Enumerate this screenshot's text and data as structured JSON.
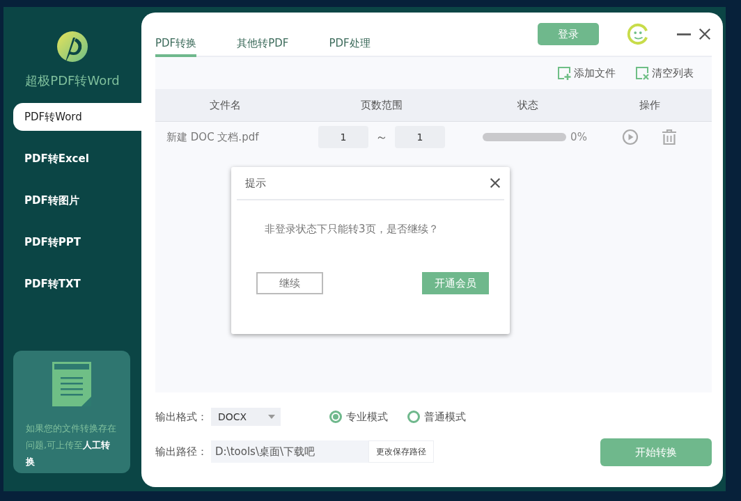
{
  "app": {
    "title": "超极PDF转Word"
  },
  "sidebar": {
    "items": [
      {
        "label": "PDF转Word",
        "selected": true
      },
      {
        "label": "PDF转Excel",
        "selected": false
      },
      {
        "label": "PDF转图片",
        "selected": false
      },
      {
        "label": "PDF转PPT",
        "selected": false
      },
      {
        "label": "PDF转TXT",
        "selected": false
      }
    ],
    "help": {
      "text": "如果您的文件转换存在问题,可上传至**人工转换**"
    }
  },
  "tabs": [
    {
      "label": "PDF转换",
      "selected": true
    },
    {
      "label": "其他转PDF",
      "selected": false
    },
    {
      "label": "PDF处理",
      "selected": false
    }
  ],
  "login_button": "登录",
  "toolbar": [
    {
      "label": "添加文件",
      "kind": "add"
    },
    {
      "label": "清空列表",
      "kind": "clear"
    }
  ],
  "table": {
    "columns": [
      "文件名",
      "页数范围",
      "状态",
      "操作"
    ],
    "rows": [
      {
        "file_name": "新建 DOC 文档.pdf",
        "page_from": "1",
        "separator": "～",
        "page_to": "1",
        "level": 0,
        "progress": "0%"
      }
    ]
  },
  "output": {
    "format_label": "输出格式：",
    "format": "DOCX",
    "modes": [
      {
        "label": "专业模式",
        "selected": true
      },
      {
        "label": "普通模式",
        "selected": false
      }
    ],
    "path_label": "输出路径：",
    "path": "D:\\tools\\桌面\\下载吧",
    "change_path_button": "更改保存路径",
    "start_button": "开始转换"
  },
  "dialog": {
    "title": "提示",
    "message": "非登录状态下只能转3页，是否继续？",
    "buttons": [
      {
        "label": "继续",
        "kind": "secondary"
      },
      {
        "label": "开通会员",
        "kind": "primary"
      }
    ]
  }
}
